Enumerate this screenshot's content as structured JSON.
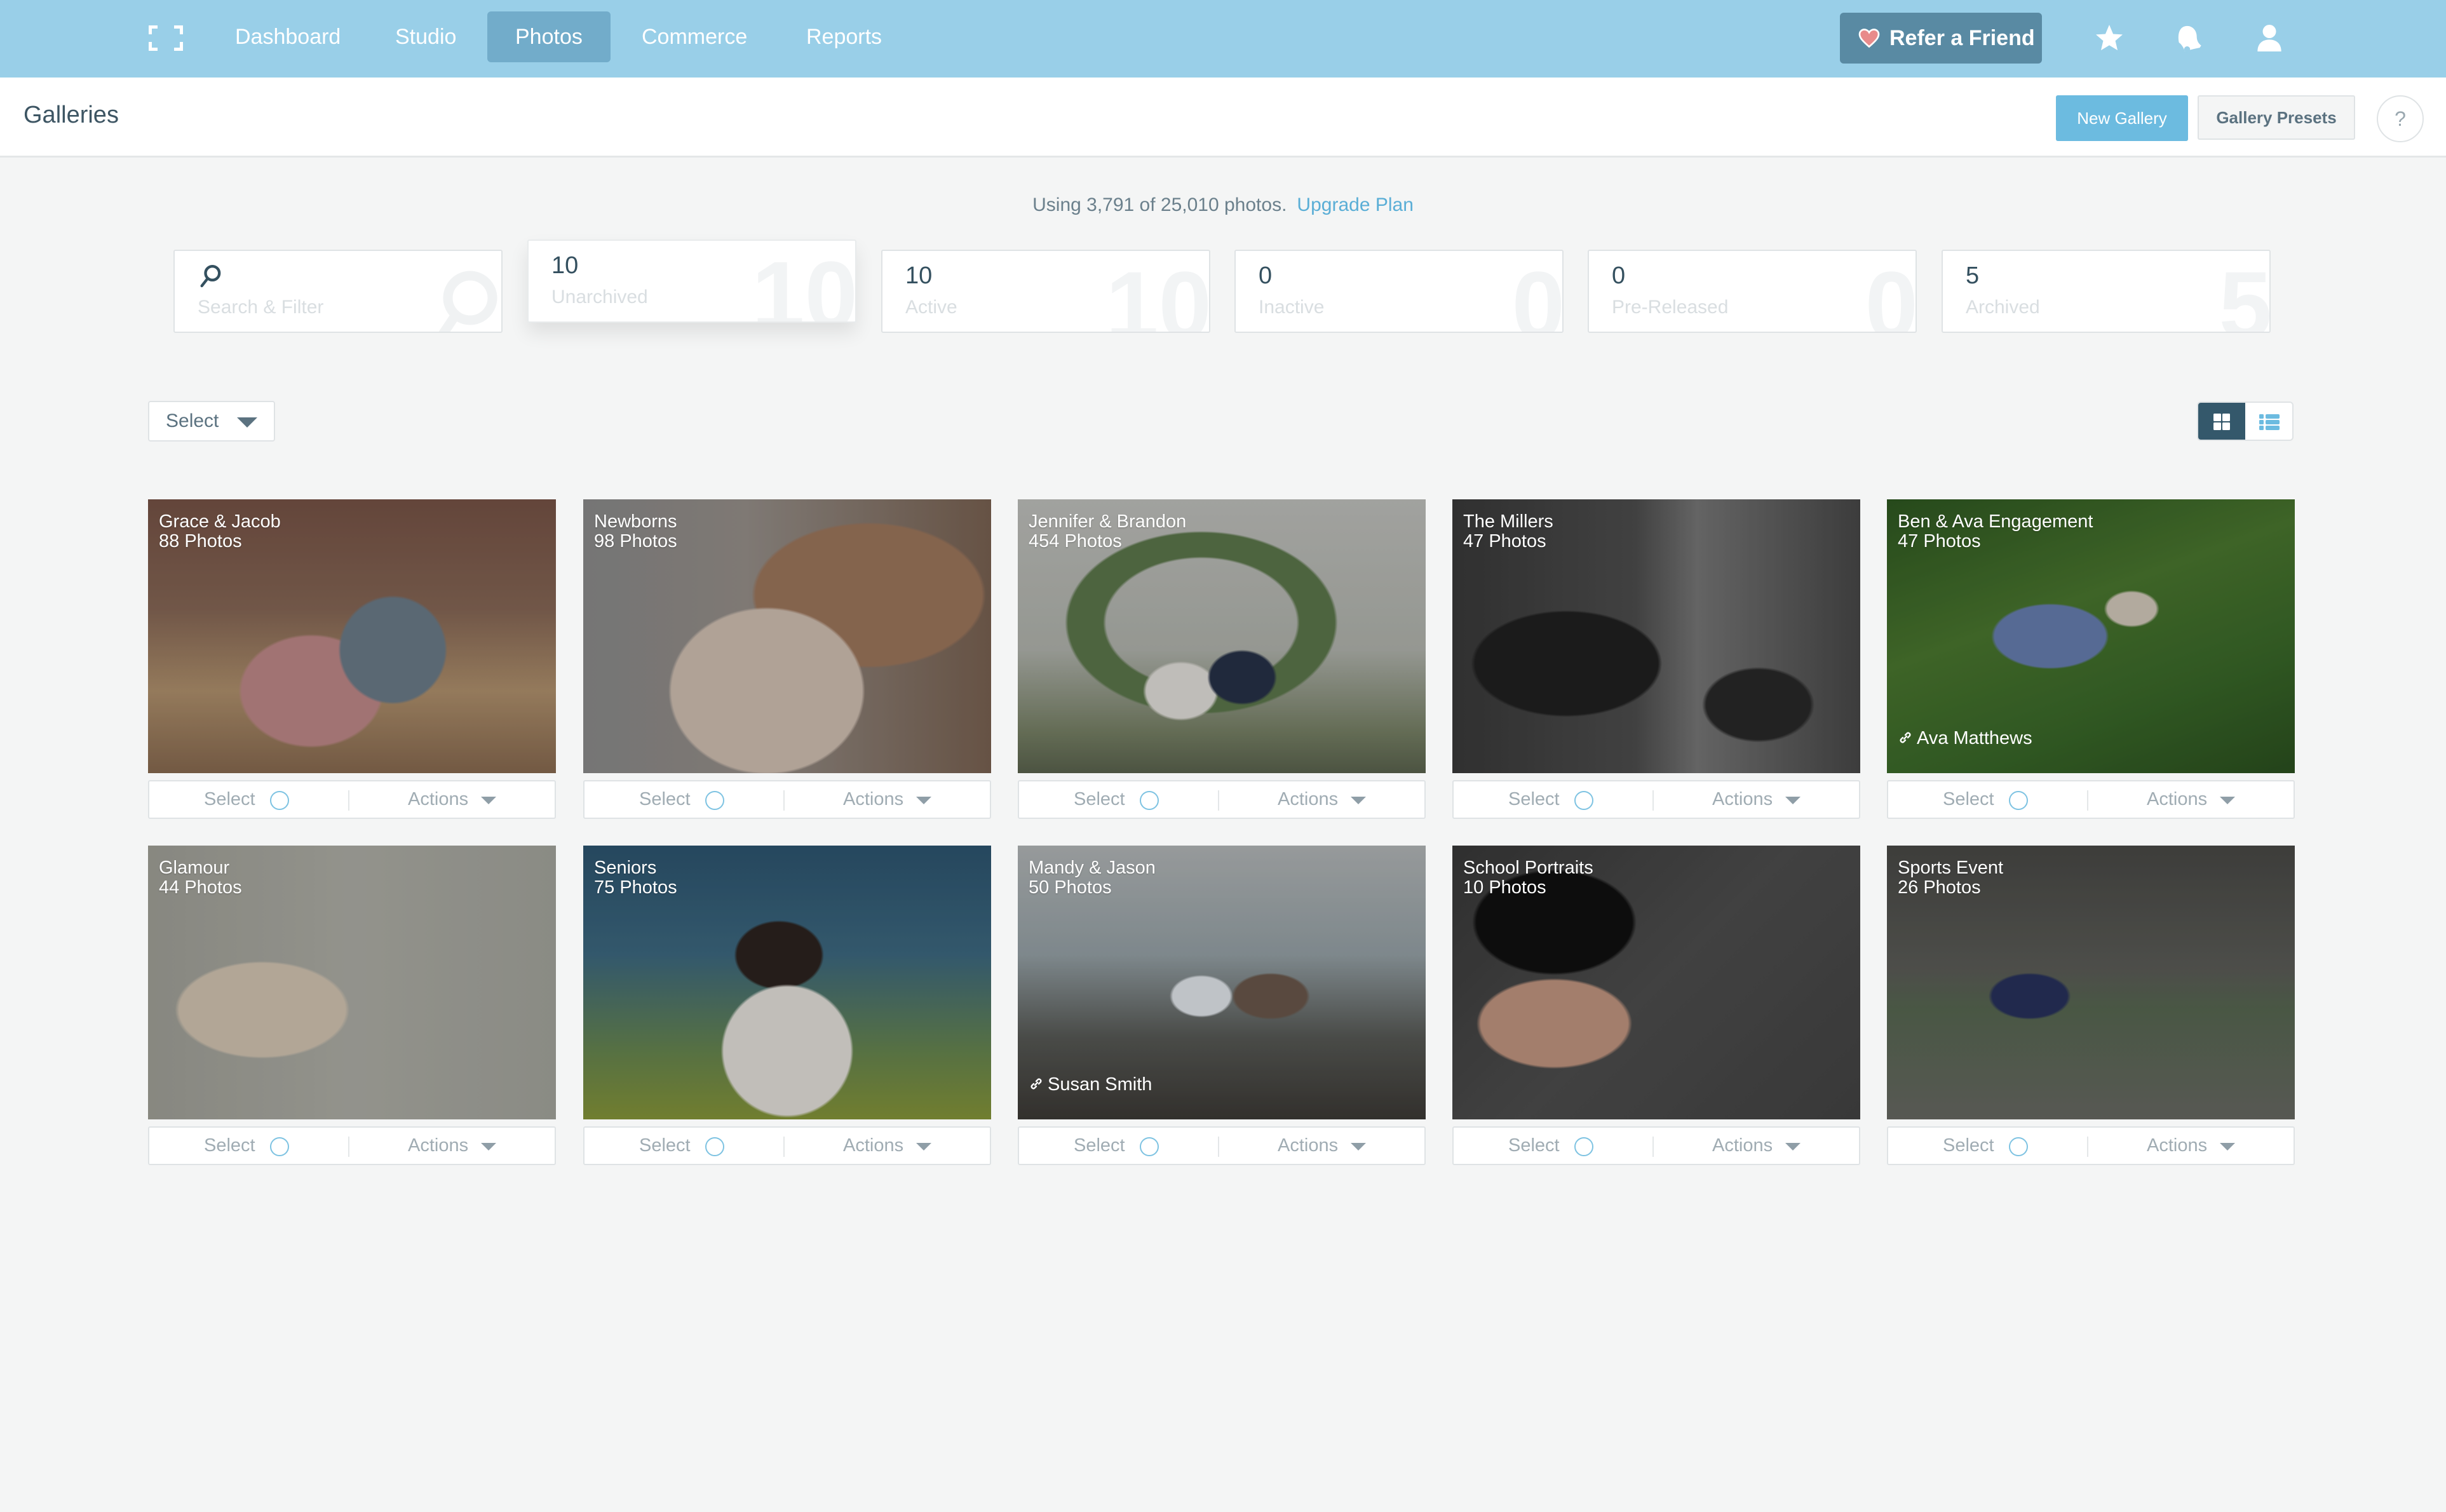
{
  "nav": {
    "logo_icon": "fullscreen-brackets-icon",
    "items": [
      {
        "label": "Dashboard",
        "active": false
      },
      {
        "label": "Studio",
        "active": false
      },
      {
        "label": "Photos",
        "active": true
      },
      {
        "label": "Commerce",
        "active": false
      },
      {
        "label": "Reports",
        "active": false
      }
    ],
    "refer_label": "Refer a Friend",
    "refer_icon": "heart-icon",
    "icons": [
      "star-icon",
      "bell-icon",
      "user-icon"
    ]
  },
  "subheader": {
    "title": "Galleries",
    "new_gallery": "New Gallery",
    "gallery_presets": "Gallery Presets",
    "help": "?"
  },
  "usage": {
    "text": "Using 3,791 of 25,010 photos.",
    "upgrade_link": "Upgrade Plan"
  },
  "stats": {
    "search_placeholder": "Search & Filter",
    "tiles": [
      {
        "value": "10",
        "label": "Unarchived",
        "selected": true
      },
      {
        "value": "10",
        "label": "Active",
        "selected": false
      },
      {
        "value": "0",
        "label": "Inactive",
        "selected": false
      },
      {
        "value": "0",
        "label": "Pre-Released",
        "selected": false
      },
      {
        "value": "5",
        "label": "Archived",
        "selected": false
      }
    ]
  },
  "toolbar": {
    "select_label": "Select",
    "view_mode": "grid"
  },
  "card_labels": {
    "select": "Select",
    "actions": "Actions"
  },
  "galleries": [
    {
      "name": "Grace & Jacob",
      "count": "88 Photos",
      "client": null
    },
    {
      "name": "Newborns",
      "count": "98 Photos",
      "client": null
    },
    {
      "name": "Jennifer & Brandon",
      "count": "454 Photos",
      "client": null
    },
    {
      "name": "The Millers",
      "count": "47 Photos",
      "client": null
    },
    {
      "name": "Ben & Ava Engagement",
      "count": "47 Photos",
      "client": "Ava Matthews"
    },
    {
      "name": "Glamour",
      "count": "44 Photos",
      "client": null
    },
    {
      "name": "Seniors",
      "count": "75 Photos",
      "client": null
    },
    {
      "name": "Mandy & Jason",
      "count": "50 Photos",
      "client": "Susan Smith"
    },
    {
      "name": "School Portraits",
      "count": "10 Photos",
      "client": null
    },
    {
      "name": "Sports Event",
      "count": "26 Photos",
      "client": null
    }
  ],
  "colors": {
    "nav_bg": "#99cfe8",
    "nav_active": "#72acca",
    "refer_bg": "#598aa3",
    "primary_button": "#6cbbe0",
    "link": "#5aaed6",
    "dark": "#34586b"
  }
}
